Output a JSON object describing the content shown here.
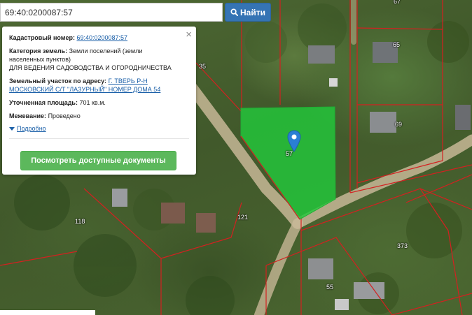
{
  "search": {
    "value": "69:40:0200087:57",
    "button_label": "Найти"
  },
  "popup": {
    "close_symbol": "×",
    "cadastral_label": "Кадастровый номер:",
    "cadastral_value": "69:40:0200087:57",
    "category_label": "Категория земель:",
    "category_value_1": "Земли поселений (земли",
    "category_value_2": "населенных пунктов)",
    "category_value_3": "ДЛЯ ВЕДЕНИЯ САДОВОДСТВА И ОГОРОДНИЧЕСТВА",
    "address_label": "Земельный участок по адресу:",
    "address_value_1": "Г. ТВЕРЬ Р-Н",
    "address_value_2": "МОСКОВСКИЙ С/Т \"ЛАЗУРНЫЙ\" НОМЕР ДОМА 54",
    "area_label": "Уточненная площадь:",
    "area_value": "701 кв.м.",
    "survey_label": "Межевание:",
    "survey_value": "Проведено",
    "more_link": "Подробно",
    "docs_button": "Посмотреть доступные документы"
  },
  "map": {
    "plot_labels": {
      "p67": "67",
      "p65": "65",
      "p69": "69",
      "p35": "35",
      "p57": "57",
      "p118": "118",
      "p121": "121",
      "p373": "373",
      "p55": "55"
    },
    "colors": {
      "selected_plot": "#22c83a",
      "boundary": "#d42020",
      "marker": "#2a7fd4",
      "road": "#c7b796"
    }
  }
}
